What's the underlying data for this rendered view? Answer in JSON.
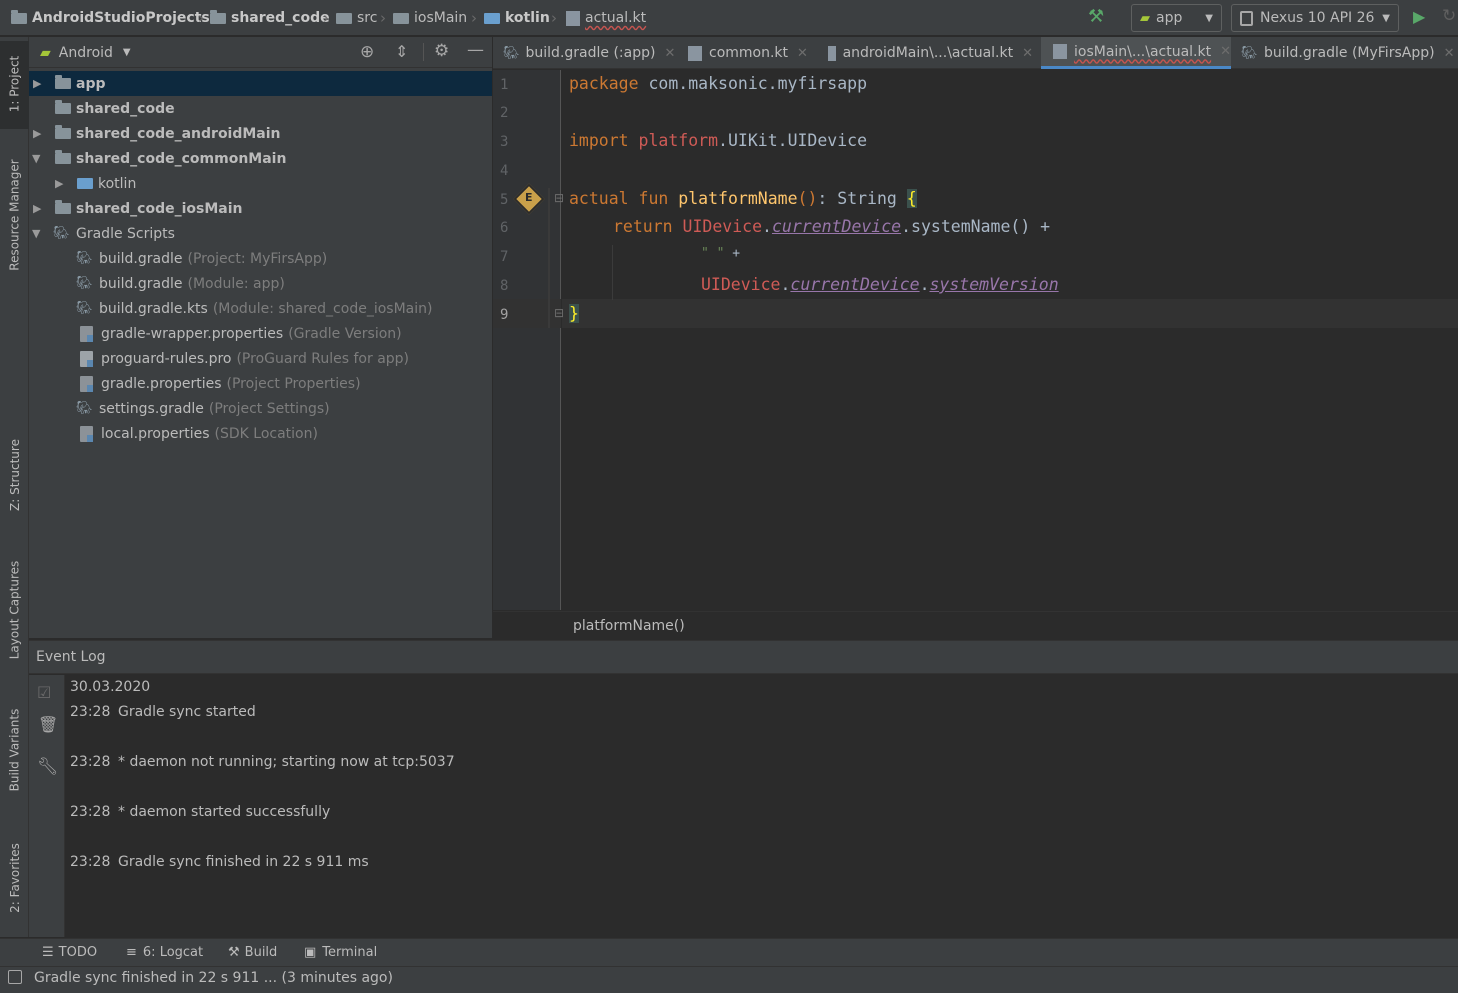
{
  "breadcrumbs": {
    "items": [
      "AndroidStudioProjects",
      "shared_code",
      "src",
      "iosMain",
      "kotlin",
      "actual.kt"
    ]
  },
  "toolbar": {
    "run_config": "app",
    "device": "Nexus 10 API 26"
  },
  "left_strip": {
    "project": "1: Project",
    "resource_manager": "Resource Manager",
    "structure": "Z: Structure",
    "layout_captures": "Layout Captures",
    "build_variants": "Build Variants",
    "favorites": "2: Favorites"
  },
  "project_panel": {
    "view_selector": "Android",
    "tree": [
      {
        "label": "app",
        "hint": ""
      },
      {
        "label": "shared_code",
        "hint": ""
      },
      {
        "label": "shared_code_androidMain",
        "hint": ""
      },
      {
        "label": "shared_code_commonMain",
        "hint": ""
      },
      {
        "label": "kotlin",
        "hint": ""
      },
      {
        "label": "shared_code_iosMain",
        "hint": ""
      },
      {
        "label": "Gradle Scripts",
        "hint": ""
      },
      {
        "label": "build.gradle",
        "hint": "(Project: MyFirsApp)"
      },
      {
        "label": "build.gradle",
        "hint": "(Module: app)"
      },
      {
        "label": "build.gradle.kts",
        "hint": "(Module: shared_code_iosMain)"
      },
      {
        "label": "gradle-wrapper.properties",
        "hint": "(Gradle Version)"
      },
      {
        "label": "proguard-rules.pro",
        "hint": "(ProGuard Rules for app)"
      },
      {
        "label": "gradle.properties",
        "hint": "(Project Properties)"
      },
      {
        "label": "settings.gradle",
        "hint": "(Project Settings)"
      },
      {
        "label": "local.properties",
        "hint": "(SDK Location)"
      }
    ]
  },
  "editor_tabs": [
    {
      "label": "build.gradle (:app)"
    },
    {
      "label": "common.kt"
    },
    {
      "label": "androidMain\\...\\actual.kt"
    },
    {
      "label": "iosMain\\...\\actual.kt"
    },
    {
      "label": "build.gradle (MyFirsApp)"
    }
  ],
  "editor": {
    "line_numbers": [
      "1",
      "2",
      "3",
      "4",
      "5",
      "6",
      "7",
      "8",
      "9"
    ],
    "code": {
      "l1_kw": "package",
      "l1_rest": " com.maksonic.myfirsapp",
      "l3_kw": "import",
      "l3_pkg": "platform",
      "l3_rest": ".UIKit.UIDevice",
      "l5_kw1": "actual",
      "l5_kw2": "fun",
      "l5_fn": "platformName",
      "l5_paren": "()",
      "l5_rest": ": String ",
      "l5_brace": "{",
      "l6_kw": "return",
      "l6_cls": "UIDevice",
      "l6_dot": ".",
      "l6_prop": "currentDevice",
      "l6_rest": ".systemName() +",
      "l7_str": "\" \"",
      "l7_rest": " +",
      "l8_cls": "UIDevice",
      "l8_dot1": ".",
      "l8_prop1": "currentDevice",
      "l8_dot2": ".",
      "l8_prop2": "systemVersion",
      "l9_brace": "}"
    },
    "breadcrumb": "platformName()",
    "gutter_badge": "E"
  },
  "event_log": {
    "title": "Event Log",
    "date": "30.03.2020",
    "entries": [
      {
        "time": "23:28",
        "text": "Gradle sync started"
      },
      {
        "time": "23:28",
        "text": "* daemon not running; starting now at tcp:5037"
      },
      {
        "time": "23:28",
        "text": "* daemon started successfully"
      },
      {
        "time": "23:28",
        "text": "Gradle sync finished in 22 s 911 ms"
      }
    ]
  },
  "bottom_tabs": {
    "todo": "TODO",
    "logcat": "6: Logcat",
    "build": "Build",
    "terminal": "Terminal"
  },
  "status": {
    "message": "Gradle sync finished in 22 s 911 ... (3 minutes ago)"
  },
  "colors": {
    "keyword": "#cc7832",
    "function": "#ffc66d",
    "class_ref": "#cf5b56",
    "property": "#9876aa",
    "selection": "#0d293e",
    "run_green": "#59a869"
  }
}
